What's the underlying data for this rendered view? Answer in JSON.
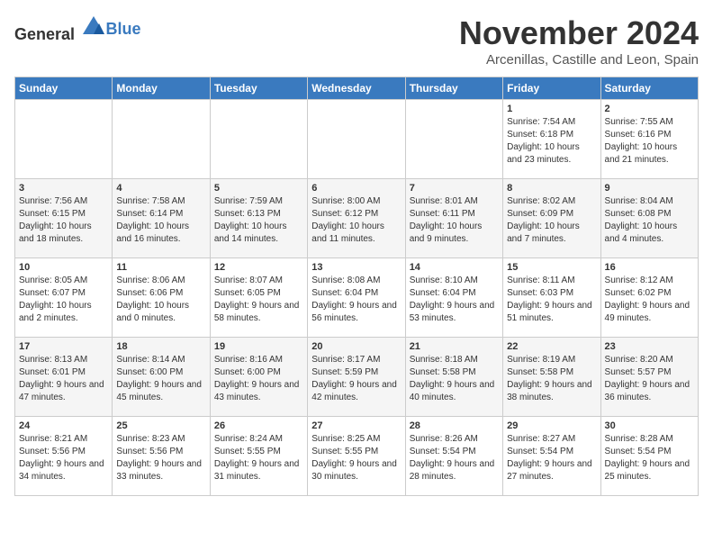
{
  "header": {
    "logo_general": "General",
    "logo_blue": "Blue",
    "month": "November 2024",
    "location": "Arcenillas, Castille and Leon, Spain"
  },
  "days_of_week": [
    "Sunday",
    "Monday",
    "Tuesday",
    "Wednesday",
    "Thursday",
    "Friday",
    "Saturday"
  ],
  "weeks": [
    [
      {
        "day": "",
        "sunrise": "",
        "sunset": "",
        "daylight": ""
      },
      {
        "day": "",
        "sunrise": "",
        "sunset": "",
        "daylight": ""
      },
      {
        "day": "",
        "sunrise": "",
        "sunset": "",
        "daylight": ""
      },
      {
        "day": "",
        "sunrise": "",
        "sunset": "",
        "daylight": ""
      },
      {
        "day": "",
        "sunrise": "",
        "sunset": "",
        "daylight": ""
      },
      {
        "day": "1",
        "sunrise": "Sunrise: 7:54 AM",
        "sunset": "Sunset: 6:18 PM",
        "daylight": "Daylight: 10 hours and 23 minutes."
      },
      {
        "day": "2",
        "sunrise": "Sunrise: 7:55 AM",
        "sunset": "Sunset: 6:16 PM",
        "daylight": "Daylight: 10 hours and 21 minutes."
      }
    ],
    [
      {
        "day": "3",
        "sunrise": "Sunrise: 7:56 AM",
        "sunset": "Sunset: 6:15 PM",
        "daylight": "Daylight: 10 hours and 18 minutes."
      },
      {
        "day": "4",
        "sunrise": "Sunrise: 7:58 AM",
        "sunset": "Sunset: 6:14 PM",
        "daylight": "Daylight: 10 hours and 16 minutes."
      },
      {
        "day": "5",
        "sunrise": "Sunrise: 7:59 AM",
        "sunset": "Sunset: 6:13 PM",
        "daylight": "Daylight: 10 hours and 14 minutes."
      },
      {
        "day": "6",
        "sunrise": "Sunrise: 8:00 AM",
        "sunset": "Sunset: 6:12 PM",
        "daylight": "Daylight: 10 hours and 11 minutes."
      },
      {
        "day": "7",
        "sunrise": "Sunrise: 8:01 AM",
        "sunset": "Sunset: 6:11 PM",
        "daylight": "Daylight: 10 hours and 9 minutes."
      },
      {
        "day": "8",
        "sunrise": "Sunrise: 8:02 AM",
        "sunset": "Sunset: 6:09 PM",
        "daylight": "Daylight: 10 hours and 7 minutes."
      },
      {
        "day": "9",
        "sunrise": "Sunrise: 8:04 AM",
        "sunset": "Sunset: 6:08 PM",
        "daylight": "Daylight: 10 hours and 4 minutes."
      }
    ],
    [
      {
        "day": "10",
        "sunrise": "Sunrise: 8:05 AM",
        "sunset": "Sunset: 6:07 PM",
        "daylight": "Daylight: 10 hours and 2 minutes."
      },
      {
        "day": "11",
        "sunrise": "Sunrise: 8:06 AM",
        "sunset": "Sunset: 6:06 PM",
        "daylight": "Daylight: 10 hours and 0 minutes."
      },
      {
        "day": "12",
        "sunrise": "Sunrise: 8:07 AM",
        "sunset": "Sunset: 6:05 PM",
        "daylight": "Daylight: 9 hours and 58 minutes."
      },
      {
        "day": "13",
        "sunrise": "Sunrise: 8:08 AM",
        "sunset": "Sunset: 6:04 PM",
        "daylight": "Daylight: 9 hours and 56 minutes."
      },
      {
        "day": "14",
        "sunrise": "Sunrise: 8:10 AM",
        "sunset": "Sunset: 6:04 PM",
        "daylight": "Daylight: 9 hours and 53 minutes."
      },
      {
        "day": "15",
        "sunrise": "Sunrise: 8:11 AM",
        "sunset": "Sunset: 6:03 PM",
        "daylight": "Daylight: 9 hours and 51 minutes."
      },
      {
        "day": "16",
        "sunrise": "Sunrise: 8:12 AM",
        "sunset": "Sunset: 6:02 PM",
        "daylight": "Daylight: 9 hours and 49 minutes."
      }
    ],
    [
      {
        "day": "17",
        "sunrise": "Sunrise: 8:13 AM",
        "sunset": "Sunset: 6:01 PM",
        "daylight": "Daylight: 9 hours and 47 minutes."
      },
      {
        "day": "18",
        "sunrise": "Sunrise: 8:14 AM",
        "sunset": "Sunset: 6:00 PM",
        "daylight": "Daylight: 9 hours and 45 minutes."
      },
      {
        "day": "19",
        "sunrise": "Sunrise: 8:16 AM",
        "sunset": "Sunset: 6:00 PM",
        "daylight": "Daylight: 9 hours and 43 minutes."
      },
      {
        "day": "20",
        "sunrise": "Sunrise: 8:17 AM",
        "sunset": "Sunset: 5:59 PM",
        "daylight": "Daylight: 9 hours and 42 minutes."
      },
      {
        "day": "21",
        "sunrise": "Sunrise: 8:18 AM",
        "sunset": "Sunset: 5:58 PM",
        "daylight": "Daylight: 9 hours and 40 minutes."
      },
      {
        "day": "22",
        "sunrise": "Sunrise: 8:19 AM",
        "sunset": "Sunset: 5:58 PM",
        "daylight": "Daylight: 9 hours and 38 minutes."
      },
      {
        "day": "23",
        "sunrise": "Sunrise: 8:20 AM",
        "sunset": "Sunset: 5:57 PM",
        "daylight": "Daylight: 9 hours and 36 minutes."
      }
    ],
    [
      {
        "day": "24",
        "sunrise": "Sunrise: 8:21 AM",
        "sunset": "Sunset: 5:56 PM",
        "daylight": "Daylight: 9 hours and 34 minutes."
      },
      {
        "day": "25",
        "sunrise": "Sunrise: 8:23 AM",
        "sunset": "Sunset: 5:56 PM",
        "daylight": "Daylight: 9 hours and 33 minutes."
      },
      {
        "day": "26",
        "sunrise": "Sunrise: 8:24 AM",
        "sunset": "Sunset: 5:55 PM",
        "daylight": "Daylight: 9 hours and 31 minutes."
      },
      {
        "day": "27",
        "sunrise": "Sunrise: 8:25 AM",
        "sunset": "Sunset: 5:55 PM",
        "daylight": "Daylight: 9 hours and 30 minutes."
      },
      {
        "day": "28",
        "sunrise": "Sunrise: 8:26 AM",
        "sunset": "Sunset: 5:54 PM",
        "daylight": "Daylight: 9 hours and 28 minutes."
      },
      {
        "day": "29",
        "sunrise": "Sunrise: 8:27 AM",
        "sunset": "Sunset: 5:54 PM",
        "daylight": "Daylight: 9 hours and 27 minutes."
      },
      {
        "day": "30",
        "sunrise": "Sunrise: 8:28 AM",
        "sunset": "Sunset: 5:54 PM",
        "daylight": "Daylight: 9 hours and 25 minutes."
      }
    ]
  ]
}
